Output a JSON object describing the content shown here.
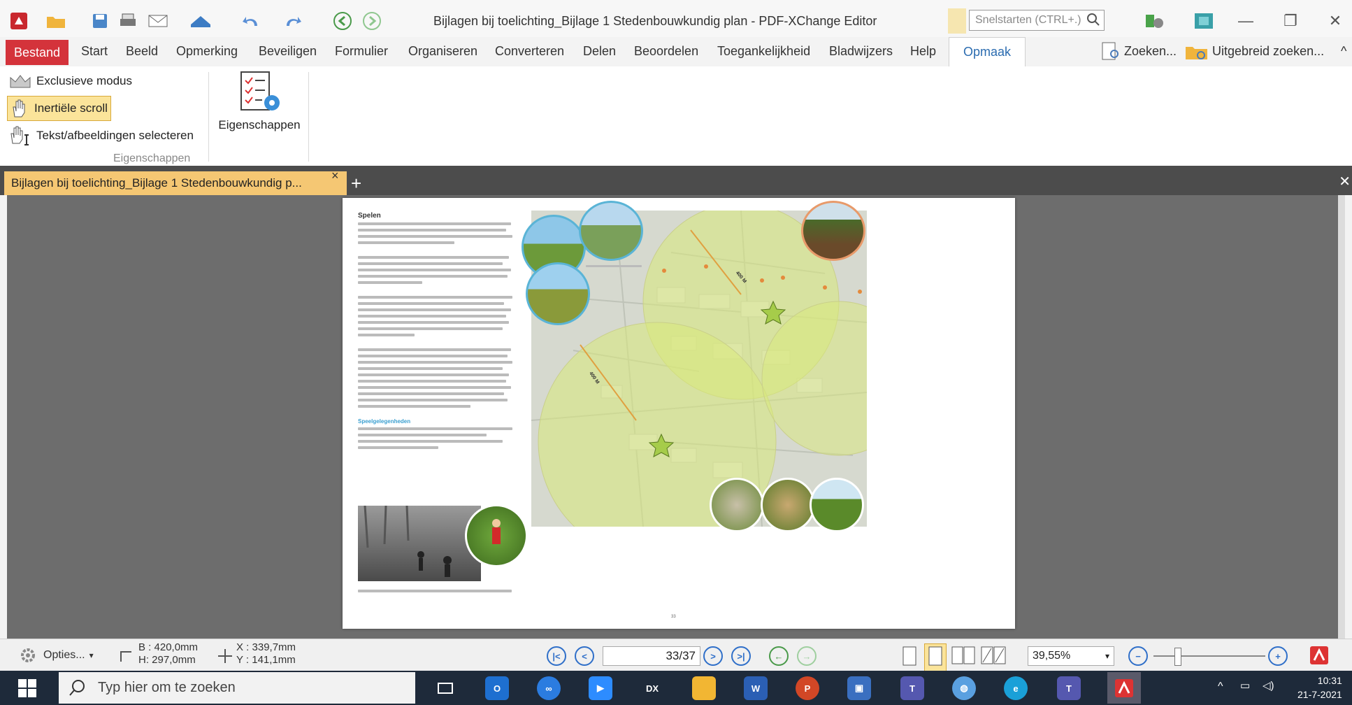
{
  "app": {
    "title": "Bijlagen bij toelichting_Bijlage 1  Stedenbouwkundig plan - PDF-XChange Editor",
    "search_placeholder": "Snelstarten (CTRL+.)"
  },
  "menu": {
    "items": [
      "Bestand",
      "Start",
      "Beeld",
      "Opmerking",
      "Beveiligen",
      "Formulier",
      "Organiseren",
      "Converteren",
      "Delen",
      "Beoordelen",
      "Toegankelijkheid",
      "Bladwijzers",
      "Help",
      "Opmaak"
    ],
    "find": "Zoeken...",
    "advanced_find": "Uitgebreid zoeken..."
  },
  "ribbon": {
    "exclusive": "Exclusieve modus",
    "inertial": "Inertiële scroll",
    "select": "Tekst/afbeeldingen selecteren",
    "group_label": "Eigenschappen",
    "properties": "Eigenschappen"
  },
  "doc_tab": {
    "label": "Bijlagen bij toelichting_Bijlage 1  Stedenbouwkundig p...",
    "close": "×",
    "new": "+"
  },
  "page": {
    "heading": "Spelen",
    "subheading": "Speelgelegenheden",
    "page_number": "33",
    "map_label_1": "400 M",
    "map_label_2": "400 M"
  },
  "status": {
    "options": "Opties...",
    "width": "B : 420,0mm",
    "height": "H: 297,0mm",
    "x": "X : 339,7mm",
    "y": "Y : 141,1mm",
    "page_indicator": "33/37",
    "zoom": "39,55%"
  },
  "taskbar": {
    "search": "Typ hier om te zoeken",
    "time": "10:31",
    "date": "21-7-2021"
  },
  "colors": {
    "file_menu": "#d4333b",
    "doc_tab": "#f5c773",
    "selected_button": "#fbe49a",
    "accent_blue": "#2f6fc9"
  }
}
